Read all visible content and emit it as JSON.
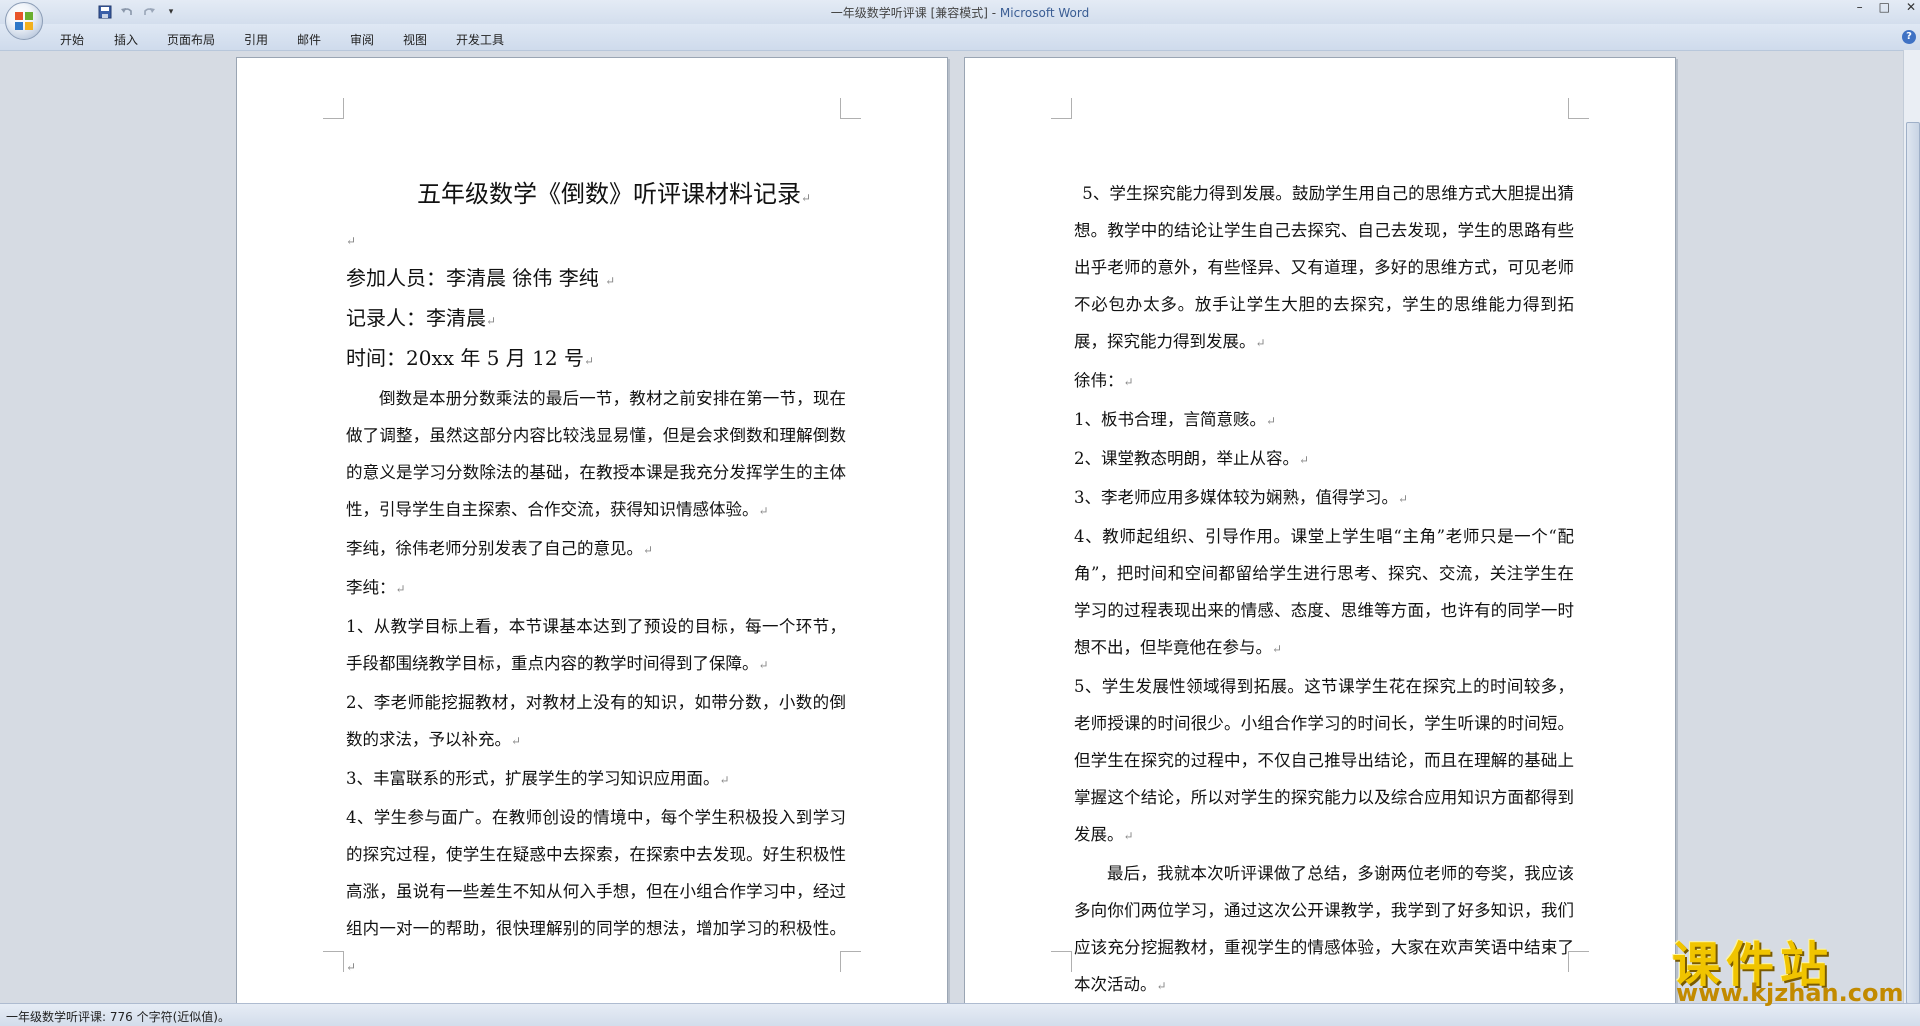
{
  "window": {
    "title": "一年级数学听评课 [兼容模式] - ",
    "app_name": "Microsoft Word",
    "controls": [
      "–",
      "□",
      "✕"
    ]
  },
  "ribbon": {
    "tabs": [
      "开始",
      "插入",
      "页面布局",
      "引用",
      "邮件",
      "审阅",
      "视图",
      "开发工具"
    ]
  },
  "page1": {
    "title": "五年级数学《倒数》听评课材料记录",
    "participants": "参加人员：李清晨 徐伟 李纯 ",
    "recorder": "记录人：李清晨",
    "time": "时间：20xx 年 5 月 12 号",
    "paragraphs": [
      "倒数是本册分数乘法的最后一节，教材之前安排在第一节，现在做了调整，虽然这部分内容比较浅显易懂，但是会求倒数和理解倒数的意义是学习分数除法的基础，在教授本课是我充分发挥学生的主体性，引导学生自主探索、合作交流，获得知识情感体验。",
      "李纯，徐伟老师分别发表了自己的意见。",
      "李纯：",
      "1、从教学目标上看，本节课基本达到了预设的目标，每一个环节，手段都围绕教学目标，重点内容的教学时间得到了保障。",
      "2、李老师能挖掘教材，对教材上没有的知识，如带分数，小数的倒数的求法，予以补充。",
      "3、丰富联系的形式，扩展学生的学习知识应用面。",
      "4、学生参与面广。在教师创设的情境中，每个学生积极投入到学习的探究过程，使学生在疑惑中去探索，在探索中去发现。好生积极性高涨，虽说有一些差生不知从何入手想，但在小组合作学习中，经过组内一对一的帮助，很快理解别的同学的想法，增加学习的积极性。"
    ]
  },
  "page2": {
    "paragraphs": [
      "5、学生探究能力得到发展。鼓励学生用自己的思维方式大胆提出猜想。教学中的结论让学生自己去探究、自己去发现，学生的思路有些出乎老师的意外，有些怪异、又有道理，多好的思维方式，可见老师不必包办太多。放手让学生大胆的去探究，学生的思维能力得到拓展，探究能力得到发展。",
      "徐伟：",
      "1、板书合理，言简意赅。",
      "2、课堂教态明朗，举止从容。",
      "3、李老师应用多媒体较为娴熟，值得学习。",
      "4、教师起组织、引导作用。课堂上学生唱“主角”老师只是一个“配角”，把时间和空间都留给学生进行思考、探究、交流，关注学生在学习的过程表现出来的情感、态度、思维等方面，也许有的同学一时想不出，但毕竟他在参与。",
      "5、学生发展性领域得到拓展。这节课学生花在探究上的时间较多，老师授课的时间很少。小组合作学习的时间长，学生听课的时间短。但学生在探究的过程中，不仅自己推导出结论，而且在理解的基础上掌握这个结论，所以对学生的探究能力以及综合应用知识方面都得到发展。",
      "最后，我就本次听评课做了总结，多谢两位老师的夸奖，我应该多向你们两位学习，通过这次公开课教学，我学到了好多知识，我们应该充分挖掘教材，重视学生的情感体验，大家在欢声笑语中结束了本次活动。"
    ]
  },
  "paragraph_mark": "↵",
  "status": {
    "text": "一年级数学听评课: 776 个字符(近似值)。"
  },
  "watermark": {
    "cn": "课件站",
    "url": "www.kjzhan.com"
  }
}
